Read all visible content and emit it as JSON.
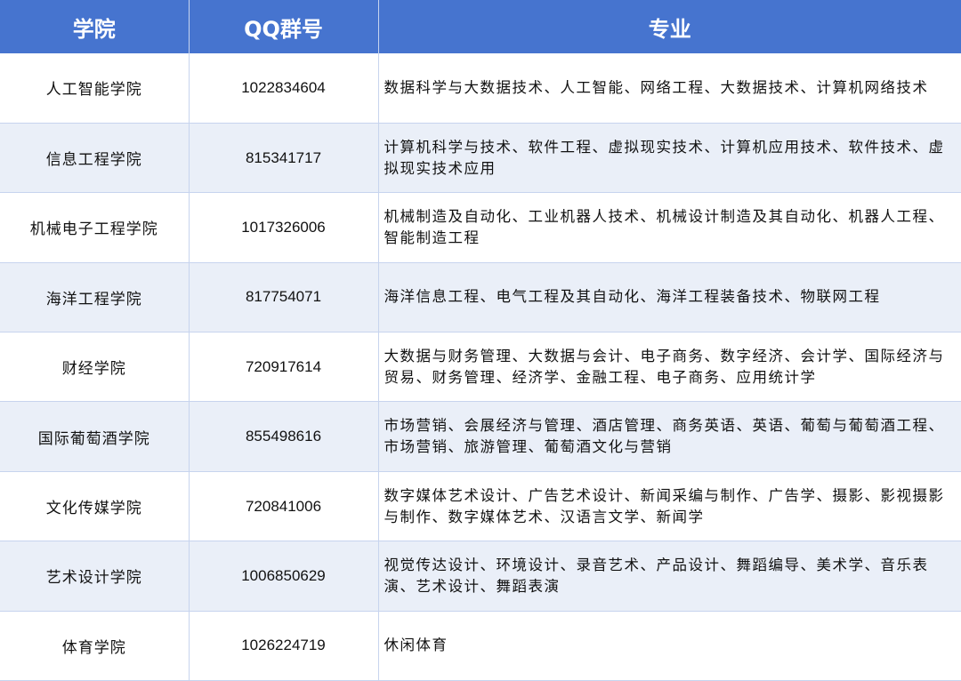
{
  "headers": {
    "college": "学院",
    "qq": "QQ群号",
    "majors": "专业"
  },
  "rows": [
    {
      "college": "人工智能学院",
      "qq": "1022834604",
      "majors": "数据科学与大数据技术、人工智能、网络工程、大数据技术、计算机网络技术"
    },
    {
      "college": "信息工程学院",
      "qq": "815341717",
      "majors": "计算机科学与技术、软件工程、虚拟现实技术、计算机应用技术、软件技术、虚拟现实技术应用"
    },
    {
      "college": "机械电子工程学院",
      "qq": "1017326006",
      "majors": "机械制造及自动化、工业机器人技术、机械设计制造及其自动化、机器人工程、智能制造工程"
    },
    {
      "college": "海洋工程学院",
      "qq": "817754071",
      "majors": "海洋信息工程、电气工程及其自动化、海洋工程装备技术、物联网工程"
    },
    {
      "college": "财经学院",
      "qq": "720917614",
      "majors": "大数据与财务管理、大数据与会计、电子商务、数字经济、会计学、国际经济与贸易、财务管理、经济学、金融工程、电子商务、应用统计学"
    },
    {
      "college": "国际葡萄酒学院",
      "qq": "855498616",
      "majors": "市场营销、会展经济与管理、酒店管理、商务英语、英语、葡萄与葡萄酒工程、市场营销、旅游管理、葡萄酒文化与营销"
    },
    {
      "college": "文化传媒学院",
      "qq": "720841006",
      "majors": "数字媒体艺术设计、广告艺术设计、新闻采编与制作、广告学、摄影、影视摄影与制作、数字媒体艺术、汉语言文学、新闻学"
    },
    {
      "college": "艺术设计学院",
      "qq": "1006850629",
      "majors": "视觉传达设计、环境设计、录音艺术、产品设计、舞蹈编导、美术学、音乐表演、艺术设计、舞蹈表演"
    },
    {
      "college": "体育学院",
      "qq": "1026224719",
      "majors": "休闲体育"
    }
  ]
}
